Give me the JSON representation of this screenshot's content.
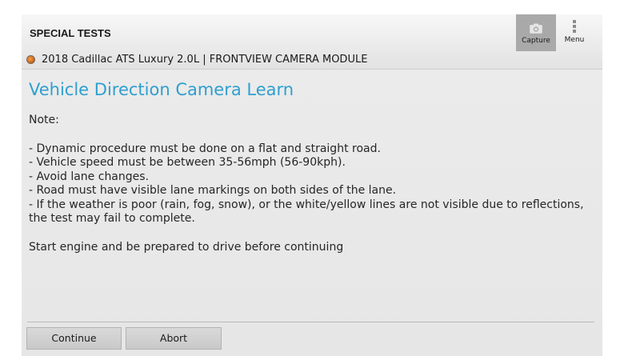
{
  "header": {
    "title": "SPECIAL TESTS",
    "vehicle_icon": "status-dot-icon",
    "vehicle": "2018 Cadillac ATS Luxury 2.0L | FRONTVIEW CAMERA MODULE",
    "capture": {
      "label": "Capture",
      "icon": "camera-icon"
    },
    "menu": {
      "label": "Menu",
      "icon": "vertical-dots-icon"
    }
  },
  "main": {
    "title": "Vehicle Direction Camera Learn",
    "note_label": "Note:",
    "instructions": [
      "- Dynamic procedure must be done on a flat and straight road.",
      "- Vehicle speed must be between 35-56mph (56-90kph).",
      "- Avoid lane changes.",
      "- Road must have visible lane markings on both sides of the lane.",
      "- If the weather is poor (rain, fog, snow), or the white/yellow lines are not visible due to reflections, the test may fail to complete."
    ],
    "prompt": "Start engine and be prepared to drive before continuing"
  },
  "footer": {
    "continue_label": "Continue",
    "abort_label": "Abort"
  },
  "colors": {
    "title_accent": "#2f9fd0",
    "capture_bg": "#a9a9a9"
  }
}
